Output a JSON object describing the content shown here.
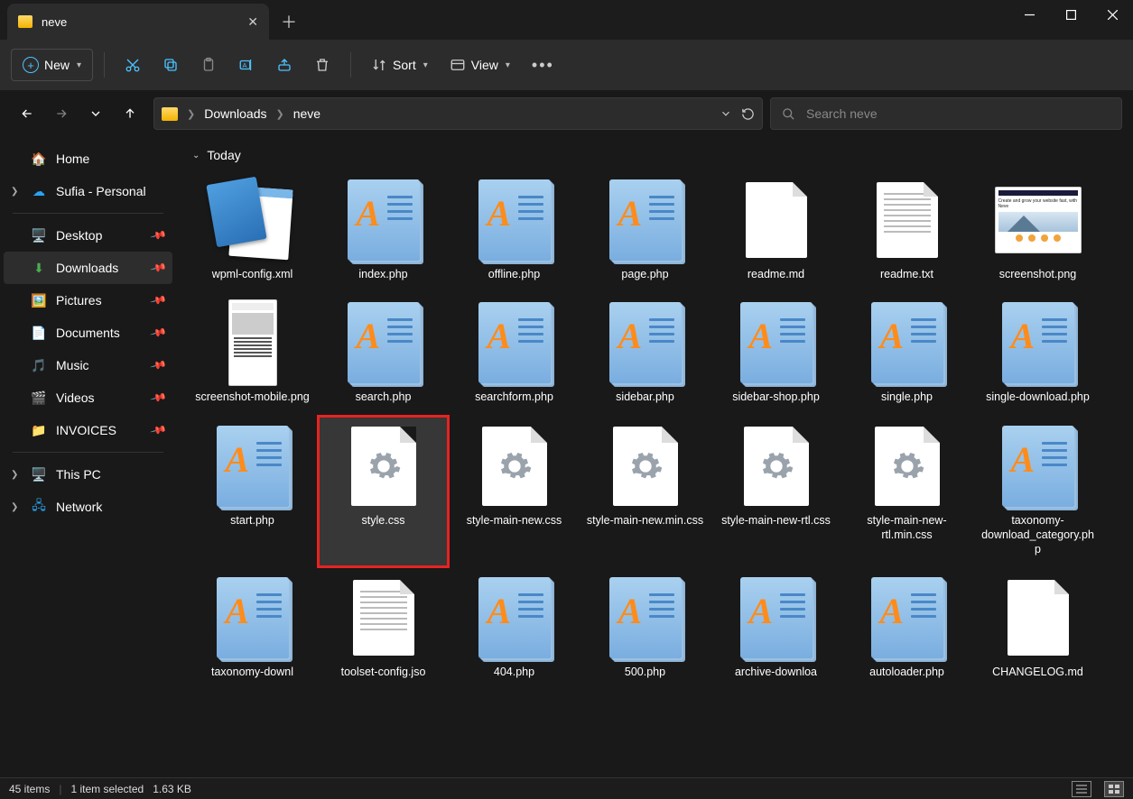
{
  "window": {
    "title": "neve"
  },
  "toolbar": {
    "new": "New",
    "sort": "Sort",
    "view": "View"
  },
  "breadcrumb": [
    "Downloads",
    "neve"
  ],
  "search": {
    "placeholder": "Search neve"
  },
  "sidebar": {
    "home": "Home",
    "onedrive": "Sufia - Personal",
    "quick": [
      {
        "label": "Desktop"
      },
      {
        "label": "Downloads"
      },
      {
        "label": "Pictures"
      },
      {
        "label": "Documents"
      },
      {
        "label": "Music"
      },
      {
        "label": "Videos"
      },
      {
        "label": "INVOICES"
      }
    ],
    "thispc": "This PC",
    "network": "Network"
  },
  "group": "Today",
  "files": [
    {
      "name": "wpml-config.xml",
      "type": "notepad"
    },
    {
      "name": "index.php",
      "type": "php"
    },
    {
      "name": "offline.php",
      "type": "php"
    },
    {
      "name": "page.php",
      "type": "php"
    },
    {
      "name": "readme.md",
      "type": "md"
    },
    {
      "name": "readme.txt",
      "type": "txt"
    },
    {
      "name": "screenshot.png",
      "type": "img-shot"
    },
    {
      "name": "screenshot-mobile.png",
      "type": "img-mobile"
    },
    {
      "name": "search.php",
      "type": "php"
    },
    {
      "name": "searchform.php",
      "type": "php"
    },
    {
      "name": "sidebar.php",
      "type": "php"
    },
    {
      "name": "sidebar-shop.php",
      "type": "php"
    },
    {
      "name": "single.php",
      "type": "php"
    },
    {
      "name": "single-download.php",
      "type": "php"
    },
    {
      "name": "start.php",
      "type": "php"
    },
    {
      "name": "style.css",
      "type": "css",
      "selected": true,
      "highlighted": true
    },
    {
      "name": "style-main-new.css",
      "type": "css"
    },
    {
      "name": "style-main-new.min.css",
      "type": "css"
    },
    {
      "name": "style-main-new-rtl.css",
      "type": "css"
    },
    {
      "name": "style-main-new-rtl.min.css",
      "type": "css"
    },
    {
      "name": "taxonomy-download_category.php",
      "type": "php"
    },
    {
      "name": "taxonomy-downl",
      "type": "php"
    },
    {
      "name": "toolset-config.jso",
      "type": "txt"
    },
    {
      "name": "404.php",
      "type": "php"
    },
    {
      "name": "500.php",
      "type": "php"
    },
    {
      "name": "archive-downloa",
      "type": "php"
    },
    {
      "name": "autoloader.php",
      "type": "php"
    },
    {
      "name": "CHANGELOG.md",
      "type": "md"
    }
  ],
  "status": {
    "count": "45 items",
    "selected": "1 item selected",
    "size": "1.63 KB"
  },
  "screenshot_texts": {
    "heading": "Create and grow your website fast, with Neve"
  }
}
